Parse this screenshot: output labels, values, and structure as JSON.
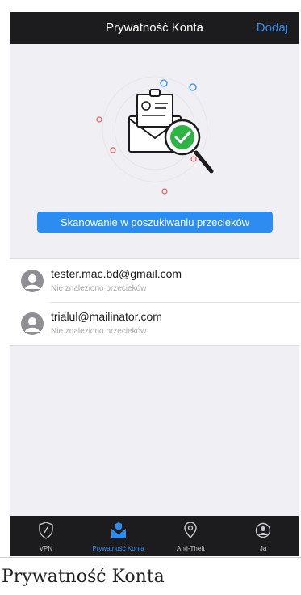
{
  "navbar": {
    "title": "Prywatność Konta",
    "add_label": "Dodaj"
  },
  "hero": {
    "scan_button": "Skanowanie w poszukiwaniu przecieków"
  },
  "accounts": [
    {
      "email": "tester.mac.bd@gmail.com",
      "status": "Nie znaleziono przecieków"
    },
    {
      "email": "trialul@mailinator.com",
      "status": "Nie znaleziono przecieków"
    }
  ],
  "tabbar": {
    "active_tab": "Prywatność Konta",
    "tabs": [
      {
        "label": "VPN",
        "icon": "shield-icon"
      },
      {
        "label": "Prywatność Konta",
        "icon": "mail-shield-icon"
      },
      {
        "label": "Anti-Theft",
        "icon": "location-pin-icon"
      },
      {
        "label": "Ja",
        "icon": "person-icon"
      }
    ]
  },
  "caption": "Prywatność Konta",
  "colors": {
    "accent": "#2d8cf0",
    "bar_bg": "#1c1c1e",
    "check_green": "#2fb344",
    "dot_red": "#e85b5b"
  }
}
